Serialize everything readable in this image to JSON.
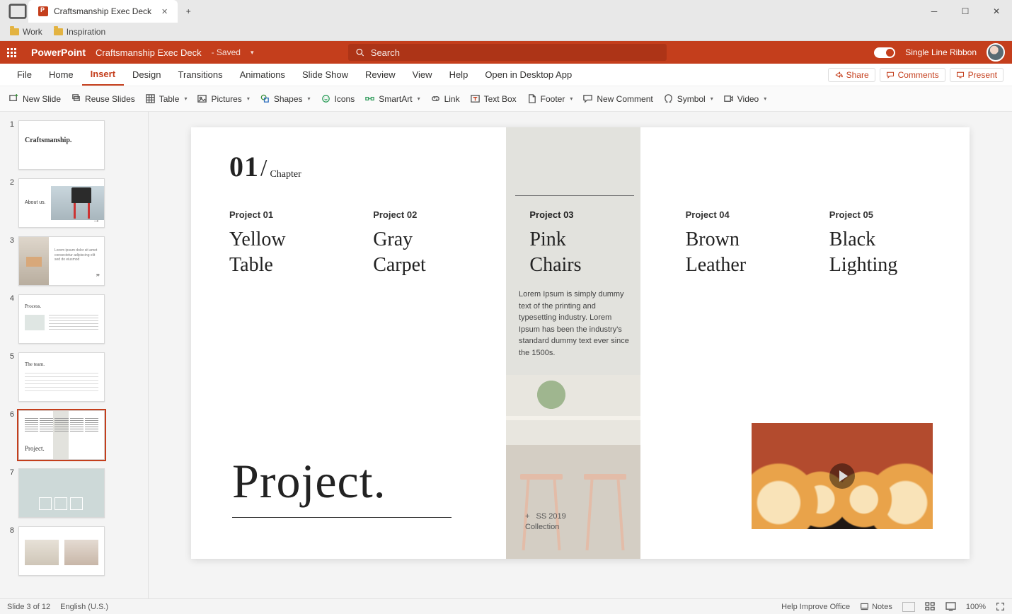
{
  "window": {
    "tab_title": "Craftsmanship Exec Deck",
    "bookmarks": [
      "Work",
      "Inspiration"
    ]
  },
  "titlebar": {
    "app": "PowerPoint",
    "doc": "Craftsmanship Exec Deck",
    "saved": "- Saved",
    "search_placeholder": "Search",
    "single_line_ribbon": "Single Line Ribbon"
  },
  "ribbon": {
    "tabs": [
      "File",
      "Home",
      "Insert",
      "Design",
      "Transitions",
      "Animations",
      "Slide Show",
      "Review",
      "View",
      "Help",
      "Open in Desktop App"
    ],
    "active_tab": "Insert",
    "right": {
      "share": "Share",
      "comments": "Comments",
      "present": "Present"
    },
    "cmds": [
      "New Slide",
      "Reuse Slides",
      "Table",
      "Pictures",
      "Shapes",
      "Icons",
      "SmartArt",
      "Link",
      "Text Box",
      "Footer",
      "New Comment",
      "Symbol",
      "Video"
    ],
    "cmds_dropdown": [
      false,
      false,
      true,
      true,
      true,
      false,
      true,
      false,
      false,
      true,
      false,
      true,
      true
    ]
  },
  "thumbnails": {
    "count": 8,
    "selected": 6,
    "labels": [
      "Craftsmanship.",
      "About us.",
      "",
      "Process.",
      "The team.",
      "Project.",
      "",
      ""
    ]
  },
  "slide": {
    "chapter_num": "01",
    "chapter_label": "Chapter",
    "projects": [
      {
        "label": "Project 01",
        "name_line1": "Yellow",
        "name_line2": "Table"
      },
      {
        "label": "Project 02",
        "name_line1": "Gray",
        "name_line2": "Carpet"
      },
      {
        "label": "Project 03",
        "name_line1": "Pink",
        "name_line2": "Chairs"
      },
      {
        "label": "Project 04",
        "name_line1": "Brown",
        "name_line2": "Leather"
      },
      {
        "label": "Project 05",
        "name_line1": "Black",
        "name_line2": "Lighting"
      }
    ],
    "description": "Lorem Ipsum is simply dummy text of the printing and typesetting industry. Lorem Ipsum has been the industry's standard dummy text ever since the 1500s.",
    "big_title": "Project.",
    "collection_line1": "SS 2019",
    "collection_line2": "Collection"
  },
  "status": {
    "slide_info": "Slide 3 of 12",
    "lang": "English (U.S.)",
    "help": "Help Improve Office",
    "notes": "Notes",
    "zoom": "100%"
  }
}
